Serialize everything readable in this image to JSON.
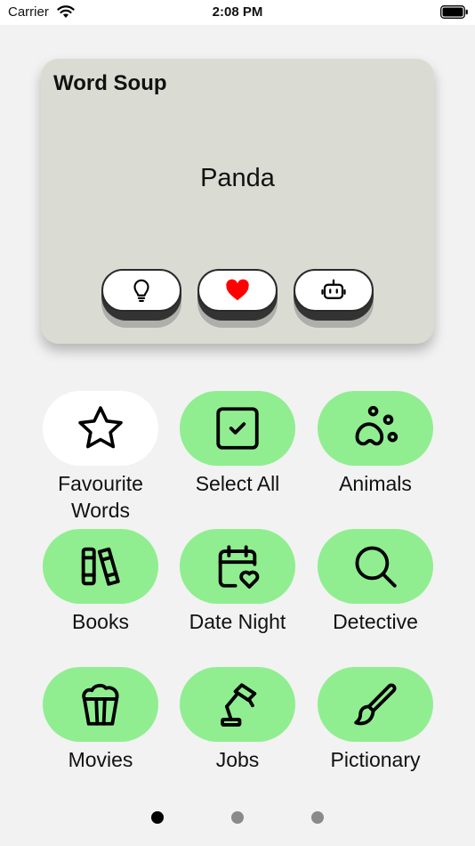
{
  "status_bar": {
    "carrier": "Carrier",
    "time": "2:08 PM"
  },
  "card": {
    "title": "Word Soup",
    "word": "Panda",
    "buttons": [
      {
        "icon": "lightbulb-icon"
      },
      {
        "icon": "heart-icon",
        "color": "#ff0000"
      },
      {
        "icon": "robot-icon"
      }
    ]
  },
  "categories": [
    {
      "label": "Favourite Words",
      "icon": "star-icon",
      "selected": false
    },
    {
      "label": "Select All",
      "icon": "checkbox-icon",
      "selected": true
    },
    {
      "label": "Animals",
      "icon": "paw-icon",
      "selected": true
    },
    {
      "label": "Books",
      "icon": "books-icon",
      "selected": true
    },
    {
      "label": "Date Night",
      "icon": "calendar-heart-icon",
      "selected": true
    },
    {
      "label": "Detective",
      "icon": "magnifier-icon",
      "selected": true
    },
    {
      "label": "Movies",
      "icon": "popcorn-icon",
      "selected": true
    },
    {
      "label": "Jobs",
      "icon": "desk-lamp-icon",
      "selected": true
    },
    {
      "label": "Pictionary",
      "icon": "brush-icon",
      "selected": true
    }
  ],
  "colors": {
    "selected": "#90ee90",
    "unselected": "#ffffff",
    "card": "#dadbd3",
    "background": "#f2f2f2"
  },
  "pager": {
    "pages": 3,
    "current": 1
  }
}
